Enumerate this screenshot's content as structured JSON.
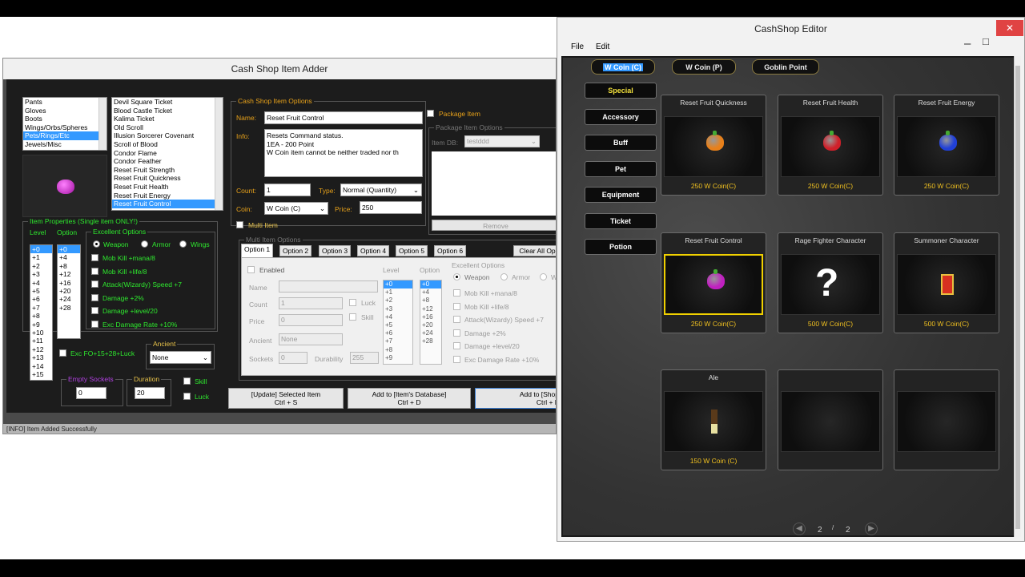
{
  "adder": {
    "title": "Cash Shop Item Adder",
    "status": "[INFO] Item Added Successfully",
    "categories": [
      "Pants",
      "Gloves",
      "Boots",
      "Wings/Orbs/Spheres",
      "Pets/Rings/Etc",
      "Jewels/Misc"
    ],
    "items": [
      "Devil Square Ticket",
      "Blood Castle Ticket",
      "Kalima Ticket",
      "Old Scroll",
      "Illusion Sorcerer Covenant",
      "Scroll of Blood",
      "Condor Flame",
      "Condor Feather",
      "Reset Fruit Strength",
      "Reset Fruit Quickness",
      "Reset Fruit Health",
      "Reset Fruit Energy",
      "Reset Fruit Control"
    ],
    "item_props": {
      "title": "Item Properties (Single item ONLY!)",
      "level_label": "Level",
      "option_label": "Option",
      "levels": [
        "+0",
        "+1",
        "+2",
        "+3",
        "+4",
        "+5",
        "+6",
        "+7",
        "+8",
        "+9",
        "+10",
        "+11",
        "+12",
        "+13",
        "+14",
        "+15"
      ],
      "options": [
        "+0",
        "+4",
        "+8",
        "+12",
        "+16",
        "+20",
        "+24",
        "+28"
      ],
      "excellent_title": "Excellent Options",
      "weapon": "Weapon",
      "armor": "Armor",
      "wings": "Wings",
      "exc_opts": [
        "Mob Kill +mana/8",
        "Mob Kill +life/8",
        "Attack(Wizardy) Speed +7",
        "Damage +2%",
        "Damage +level/20",
        "Exc Damage Rate +10%"
      ],
      "exc_fo": "Exc FO+15+28+Luck",
      "ancient_title": "Ancient",
      "ancient_value": "None",
      "sockets_title": "Empty Sockets",
      "sockets_value": "0",
      "duration_title": "Duration",
      "duration_value": "20",
      "skill": "Skill",
      "luck": "Luck"
    },
    "cs_opts": {
      "title": "Cash Shop Item Options",
      "name_label": "Name:",
      "name_value": "Reset Fruit Control",
      "info_label": "Info:",
      "info_lines": [
        "Resets Command status.",
        "1EA - 200 Point",
        "W Coin item cannot be neither traded nor th"
      ],
      "count_label": "Count:",
      "count_value": "1",
      "type_label": "Type:",
      "type_value": "Normal (Quantity)",
      "coin_label": "Coin:",
      "coin_value": "W Coin (C)",
      "price_label": "Price:",
      "price_value": "250",
      "multi_item": "Multi Item",
      "package_item": "Package Item",
      "package_opts": "Package Item Options",
      "item_db_label": "Item DB:",
      "item_db_value": "testddd",
      "remove": "Remove"
    },
    "multi": {
      "title": "Multi Item Options",
      "tabs": [
        "Option 1",
        "Option 2",
        "Option 3",
        "Option 4",
        "Option 5",
        "Option 6"
      ],
      "clear_all": "Clear All Op",
      "enabled": "Enabled",
      "name": "Name",
      "count": "Count",
      "count_value": "1",
      "price": "Price",
      "price_value": "0",
      "ancient": "Ancient",
      "ancient_value": "None",
      "sockets": "Sockets",
      "sockets_value": "0",
      "durability": "Durability",
      "durability_value": "255",
      "luck": "Luck",
      "skill": "Skill",
      "level": "Level",
      "option": "Option",
      "levels": [
        "+0",
        "+1",
        "+2",
        "+3",
        "+4",
        "+5",
        "+6",
        "+7",
        "+8",
        "+9"
      ],
      "options": [
        "+0",
        "+4",
        "+8",
        "+12",
        "+16",
        "+20",
        "+24",
        "+28"
      ],
      "excellent": "Excellent Options",
      "weapon": "Weapon",
      "armor": "Armor",
      "w": "W",
      "exc_opts": [
        "Mob Kill +mana/8",
        "Mob Kill +life/8",
        "Attack(Wizardy) Speed +7",
        "Damage +2%",
        "Damage +level/20",
        "Exc Damage Rate +10%"
      ]
    },
    "buttons": {
      "update": "[Update] Selected Item",
      "update_sc": "Ctrl + S",
      "add_db": "Add to [Item's Database]",
      "add_db_sc": "Ctrl + D",
      "add_shop": "Add to [Shop",
      "add_shop_sc": "Ctrl + F"
    }
  },
  "editor": {
    "title": "CashShop Editor",
    "menu": [
      "File",
      "Edit"
    ],
    "coin_tabs": [
      "W Coin (C)",
      "W Coin (P)",
      "Goblin Point"
    ],
    "categories": [
      "Special",
      "Accessory",
      "Buff",
      "Pet",
      "Equipment",
      "Ticket",
      "Potion"
    ],
    "cards": [
      {
        "name": "Reset Fruit Quickness",
        "price": "250 W Coin(C)",
        "icon": "fruit-orange-icon",
        "color": "#e8801a"
      },
      {
        "name": "Reset Fruit Health",
        "price": "250 W Coin(C)",
        "icon": "fruit-red-icon",
        "color": "#d0202a"
      },
      {
        "name": "Reset Fruit Energy",
        "price": "250 W Coin(C)",
        "icon": "fruit-blue-icon",
        "color": "#2040d8"
      },
      {
        "name": "Reset Fruit Control",
        "price": "250 W Coin(C)",
        "icon": "fruit-magenta-icon",
        "color": "#c020c0"
      },
      {
        "name": "Rage Fighter Character",
        "price": "500 W Coin(C)",
        "icon": "question-mark-icon",
        "color": "#ffffff"
      },
      {
        "name": "Summoner Character",
        "price": "500 W Coin(C)",
        "icon": "scroll-icon",
        "color": "#d83020"
      },
      {
        "name": "Ale",
        "price": "150 W Coin (C)",
        "icon": "bottle-icon",
        "color": "#e8e0a0"
      },
      {
        "name": "",
        "price": "",
        "icon": "",
        "color": ""
      },
      {
        "name": "",
        "price": "",
        "icon": "",
        "color": ""
      }
    ],
    "page_current": "2",
    "page_total": "2",
    "page_sep": "/"
  }
}
